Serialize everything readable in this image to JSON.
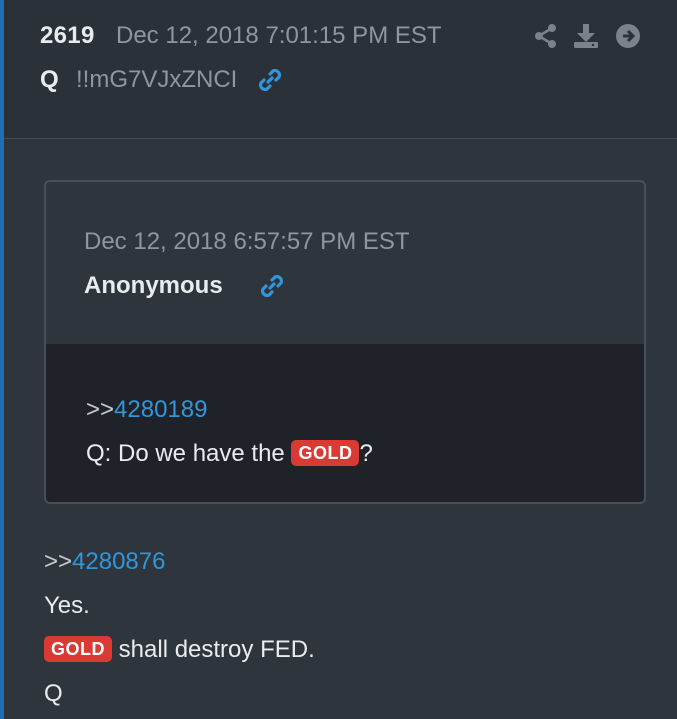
{
  "post": {
    "number": "2619",
    "date": "Dec 12, 2018 7:01:15 PM EST",
    "author": "Q",
    "tripcode": "!!mG7VJxZNCI",
    "icons": {
      "share": "share-icon",
      "download": "download-icon",
      "next": "arrow-right-circle-icon",
      "link": "link-icon"
    }
  },
  "quoted_post": {
    "date": "Dec 12, 2018 6:57:57 PM EST",
    "author": "Anonymous",
    "gt": ">>",
    "ref": "4280189",
    "text_before": "Q: Do we have the ",
    "badge": "GOLD",
    "text_after": "?"
  },
  "body": {
    "gt": ">>",
    "ref": "4280876",
    "line1": "Yes.",
    "badge": "GOLD",
    "line2_after": " shall destroy FED.",
    "signature": "Q"
  },
  "colors": {
    "accent": "#1f6fb4",
    "link": "#3296dc",
    "badge": "#d93a34"
  }
}
